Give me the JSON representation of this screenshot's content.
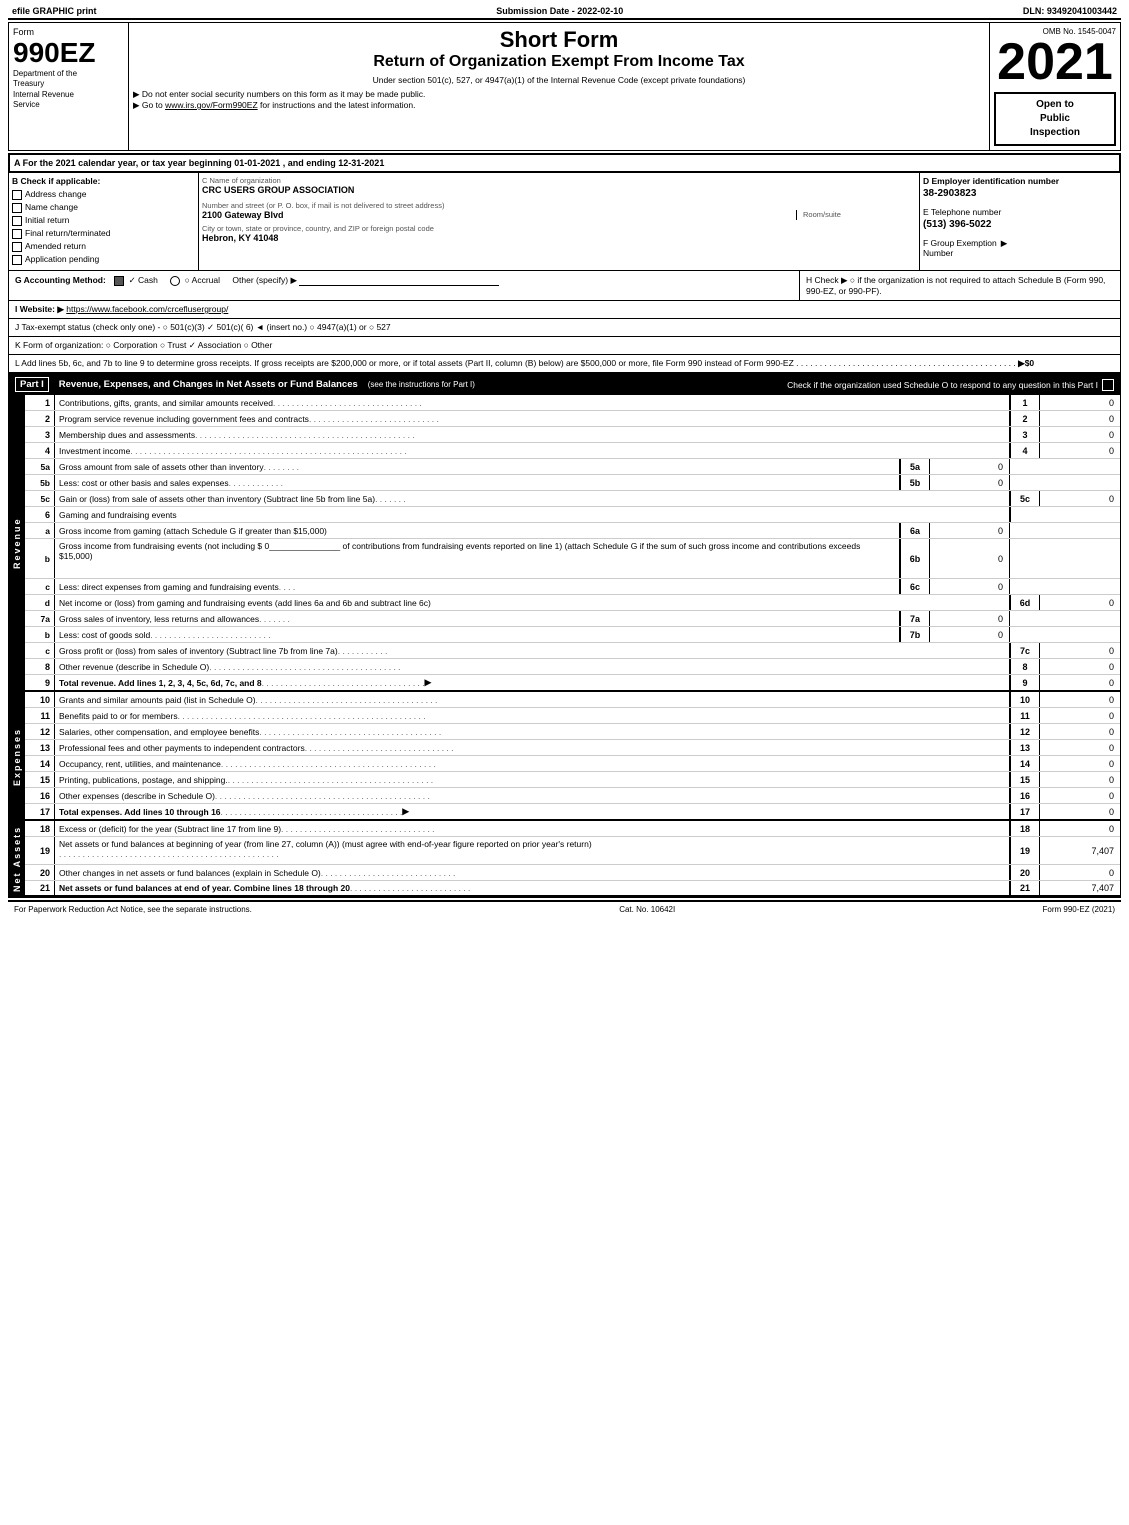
{
  "topBar": {
    "left": "efile GRAPHIC print",
    "center": "Submission Date - 2022-02-10",
    "right": "DLN: 93492041003442"
  },
  "formHeader": {
    "formLabel": "Form",
    "form990ez": "990EZ",
    "deptLine1": "Department of the",
    "deptLine2": "Treasury",
    "deptLine3": "Internal Revenue",
    "deptLine4": "Service",
    "shortForm": "Short Form",
    "returnTitle": "Return of Organization Exempt From Income Tax",
    "subtitle": "Under section 501(c), 527, or 4947(a)(1) of the Internal Revenue Code (except private foundations)",
    "bullet1": "▶ Do not enter social security numbers on this form as it may be made public.",
    "bullet2": "▶ Go to www.irs.gov/Form990EZ for instructions and the latest information.",
    "year": "2021",
    "ombNo": "OMB No. 1545-0047",
    "openPublic": "Open to\nPublic\nInspection"
  },
  "sectionA": {
    "text": "A  For the 2021 calendar year, or tax year beginning 01-01-2021 , and ending 12-31-2021"
  },
  "sectionB": {
    "label": "B  Check if applicable:",
    "checks": {
      "addressChange": {
        "label": "Address change",
        "checked": false
      },
      "nameChange": {
        "label": "Name change",
        "checked": false
      },
      "initialReturn": {
        "label": "Initial return",
        "checked": false
      },
      "finalReturn": {
        "label": "Final return/terminated",
        "checked": false
      },
      "amendedReturn": {
        "label": "Amended return",
        "checked": false
      },
      "applicationPending": {
        "label": "Application pending",
        "checked": false
      }
    }
  },
  "orgInfo": {
    "cLabel": "C Name of organization",
    "orgName": "CRC USERS GROUP ASSOCIATION",
    "addrLabel": "Number and street (or P. O. box, if mail is not delivered to street address)",
    "address": "2100 Gateway Blvd",
    "roomLabel": "Room/suite",
    "roomValue": "",
    "cityLabel": "City or town, state or province, country, and ZIP or foreign postal code",
    "cityValue": "Hebron, KY  41048",
    "dLabel": "D Employer identification number",
    "ein": "38-2903823",
    "eLabel": "E Telephone number",
    "phone": "(513) 396-5022",
    "fLabel": "F Group Exemption\nNumber",
    "fValue": "▶"
  },
  "sectionG": {
    "label": "G Accounting Method:",
    "cashLabel": "✓ Cash",
    "accrualLabel": "○ Accrual",
    "otherLabel": "Other (specify) ▶",
    "otherValue": "____________________________"
  },
  "sectionH": {
    "text": "H  Check ▶  ○ if the organization is not required to attach Schedule B (Form 990, 990-EZ, or 990-PF)."
  },
  "sectionI": {
    "label": "I Website: ▶",
    "url": "https://www.facebook.com/crceflusergroup/"
  },
  "sectionJ": {
    "text": "J Tax-exempt status (check only one) - ○ 501(c)(3) ✓ 501(c)( 6) ◄ (insert no.) ○ 4947(a)(1) or ○ 527"
  },
  "sectionK": {
    "text": "K Form of organization:  ○ Corporation  ○ Trust  ✓ Association  ○ Other"
  },
  "sectionL": {
    "text": "L Add lines 5b, 6c, and 7b to line 9 to determine gross receipts. If gross receipts are $200,000 or more, or if total assets (Part II, column (B) below) are $500,000 or more, file Form 990 instead of Form 990-EZ",
    "dots": ". . . . . . . . . . . . . . . . . . . . . . . . . . . . . . . . . . . . . . . . . . . . . . .",
    "value": "▶$0"
  },
  "partI": {
    "label": "Part I",
    "title": "Revenue, Expenses, and Changes in Net Assets or Fund Balances",
    "seeInstructions": "(see the instructions for Part I)",
    "checkText": "Check if the organization used Schedule O to respond to any question in this Part I",
    "rows": [
      {
        "num": "1",
        "desc": "Contributions, gifts, grants, and similar amounts received",
        "dots": ". . . . . . . . . . . . . . . . . . . . . . . . . . . . . . . .",
        "lineNum": "1",
        "value": "0"
      },
      {
        "num": "2",
        "desc": "Program service revenue including government fees and contracts",
        "dots": ". . . . . . . . . . . . . . . . . . . . . . . . . . . .",
        "lineNum": "2",
        "value": "0"
      },
      {
        "num": "3",
        "desc": "Membership dues and assessments",
        "dots": ". . . . . . . . . . . . . . . . . . . . . . . . . . . . . . . . . . . . . . . . . . . . . . .",
        "lineNum": "3",
        "value": "0"
      },
      {
        "num": "4",
        "desc": "Investment income",
        "dots": ". . . . . . . . . . . . . . . . . . . . . . . . . . . . . . . . . . . . . . . . . . . . . . . . . . . . . . . . . . .",
        "lineNum": "4",
        "value": "0"
      }
    ],
    "row5a": {
      "num": "5a",
      "desc": "Gross amount from sale of assets other than inventory",
      "dots": ". . . . . . . .",
      "subNum": "5a",
      "subVal": "0"
    },
    "row5b": {
      "num": "5b",
      "desc": "Less: cost or other basis and sales expenses",
      "dots": ". . . . . . . . . . . .",
      "subNum": "5b",
      "subVal": "0"
    },
    "row5c": {
      "num": "5c",
      "desc": "Gain or (loss) from sale of assets other than inventory (Subtract line 5b from line 5a)",
      "dots": ". . . . . . .",
      "lineNum": "5c",
      "value": "0"
    },
    "row6label": {
      "num": "6",
      "desc": "Gaming and fundraising events"
    },
    "row6a": {
      "sub": "a",
      "desc": "Gross income from gaming (attach Schedule G if greater than $15,000)",
      "subNum": "6a",
      "subVal": "0"
    },
    "row6b_desc": "Gross income from fundraising events (not including $ 0_______________ of contributions from fundraising events reported on line 1) (attach Schedule G if the sum of such gross income and contributions exceeds $15,000)",
    "row6b": {
      "sub": "b",
      "subNum": "6b",
      "subVal": "0"
    },
    "row6c": {
      "sub": "c",
      "desc": "Less: direct expenses from gaming and fundraising events",
      "dots": ". . . .",
      "subNum": "6c",
      "subVal": "0"
    },
    "row6d": {
      "sub": "d",
      "desc": "Net income or (loss) from gaming and fundraising events (add lines 6a and 6b and subtract line 6c)",
      "lineNum": "6d",
      "value": "0"
    },
    "row7a": {
      "sub": "7a",
      "desc": "Gross sales of inventory, less returns and allowances",
      "dots": ". . . . . . .",
      "subNum": "7a",
      "subVal": "0"
    },
    "row7b": {
      "sub": "7b",
      "desc": "Less: cost of goods sold",
      "dots": ". . . . . . . . . . . . . . . . . . . . . . . . . .",
      "subNum": "7b",
      "subVal": "0"
    },
    "row7c": {
      "num": "7c",
      "desc": "Gross profit or (loss) from sales of inventory (Subtract line 7b from line 7a)",
      "dots": ". . . . . . . . . . .",
      "lineNum": "7c",
      "value": "0"
    },
    "row8": {
      "num": "8",
      "desc": "Other revenue (describe in Schedule O)",
      "dots": ". . . . . . . . . . . . . . . . . . . . . . . . . . . . . . . . . . . . . . . . .",
      "lineNum": "8",
      "value": "0"
    },
    "row9": {
      "num": "9",
      "desc": "Total revenue. Add lines 1, 2, 3, 4, 5c, 6d, 7c, and 8",
      "dots": ". . . . . . . . . . . . . . . . . . . . . . . . . . . . . . . . . . .",
      "arrow": "▶",
      "lineNum": "9",
      "value": "0"
    }
  },
  "partI_expenses": {
    "rows": [
      {
        "num": "10",
        "desc": "Grants and similar amounts paid (list in Schedule O)",
        "dots": ". . . . . . . . . . . . . . . . . . . . . . . . . . . . . . . . . . . . . . .",
        "lineNum": "10",
        "value": "0"
      },
      {
        "num": "11",
        "desc": "Benefits paid to or for members",
        "dots": ". . . . . . . . . . . . . . . . . . . . . . . . . . . . . . . . . . . . . . . . . . . . . . . . . . . . .",
        "lineNum": "11",
        "value": "0"
      },
      {
        "num": "12",
        "desc": "Salaries, other compensation, and employee benefits",
        "dots": ". . . . . . . . . . . . . . . . . . . . . . . . . . . . . . . . . . . . . . .",
        "lineNum": "12",
        "value": "0"
      },
      {
        "num": "13",
        "desc": "Professional fees and other payments to independent contractors",
        "dots": ". . . . . . . . . . . . . . . . . . . . . . . . . . . . . . . .",
        "lineNum": "13",
        "value": "0"
      },
      {
        "num": "14",
        "desc": "Occupancy, rent, utilities, and maintenance",
        "dots": ". . . . . . . . . . . . . . . . . . . . . . . . . . . . . . . . . . . . . . . . . . . . . .",
        "lineNum": "14",
        "value": "0"
      },
      {
        "num": "15",
        "desc": "Printing, publications, postage, and shipping.",
        "dots": ". . . . . . . . . . . . . . . . . . . . . . . . . . . . . . . . . . . . . . . . . . . .",
        "lineNum": "15",
        "value": "0"
      },
      {
        "num": "16",
        "desc": "Other expenses (describe in Schedule O)",
        "dots": ". . . . . . . . . . . . . . . . . . . . . . . . . . . . . . . . . . . . . . . . . . . . . .",
        "lineNum": "16",
        "value": "0"
      },
      {
        "num": "17",
        "desc": "Total expenses. Add lines 10 through 16",
        "dots": ". . . . . . . . . . . . . . . . . . . . . . . . . . . . . . . . . . . . . . .",
        "arrow": "▶",
        "lineNum": "17",
        "value": "0",
        "bold": true
      }
    ]
  },
  "partI_netAssets": {
    "rows": [
      {
        "num": "18",
        "desc": "Excess or (deficit) for the year (Subtract line 17 from line 9)",
        "dots": ". . . . . . . . . . . . . . . . . . . . . . . . . . . . . . . . .",
        "lineNum": "18",
        "value": "0"
      },
      {
        "num": "19",
        "desc": "Net assets or fund balances at beginning of year (from line 27, column (A)) (must agree with end-of-year figure reported on prior year's return)",
        "dots": ". . . . . . . . . . . . . . . . . . . . . . . . . . . . . . . . . . . . . . . . . . . . . . .",
        "lineNum": "19",
        "value": "7,407"
      },
      {
        "num": "20",
        "desc": "Other changes in net assets or fund balances (explain in Schedule O)",
        "dots": ". . . . . . . . . . . . . . . . . . . . . . . . . . . . .",
        "lineNum": "20",
        "value": "0"
      },
      {
        "num": "21",
        "desc": "Net assets or fund balances at end of year. Combine lines 18 through 20",
        "dots": ". . . . . . . . . . . . . . . . . . . . . . . . . .",
        "lineNum": "21",
        "value": "7,407",
        "bold": true
      }
    ]
  },
  "footer": {
    "left": "For Paperwork Reduction Act Notice, see the separate instructions.",
    "center": "Cat. No. 10642I",
    "right": "Form 990-EZ (2021)"
  },
  "sideLabels": {
    "revenue": "Revenue",
    "expenses": "Expenses",
    "netAssets": "Net Assets"
  }
}
